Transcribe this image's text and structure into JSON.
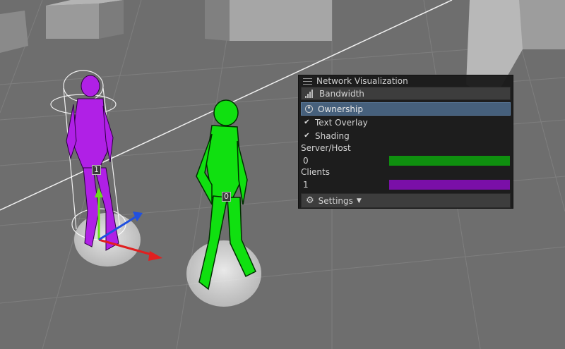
{
  "scene": {
    "labels": [
      {
        "id": "player-1-id-label",
        "text": "1"
      },
      {
        "id": "player-0-id-label",
        "text": "0"
      }
    ],
    "colors": {
      "server_host": "#0f8f0f",
      "client": "#7a0fa8",
      "character_server": "#00d600",
      "character_client": "#b020e6"
    }
  },
  "panel": {
    "title": "Network Visualization",
    "bandwidth_label": "Bandwidth",
    "ownership_label": "Ownership",
    "text_overlay_label": "Text Overlay",
    "shading_label": "Shading",
    "text_overlay_checked": true,
    "shading_checked": true,
    "server_host_label": "Server/Host",
    "server_host_count": "0",
    "clients_label": "Clients",
    "clients_count": "1",
    "settings_label": "Settings",
    "active_mode": "Ownership",
    "check_glyph": "✔",
    "gear_glyph": "⚙",
    "caret_glyph": "▼",
    "icons": [
      "grip-icon",
      "bandwidth-icon",
      "user-circle-icon",
      "gear-icon",
      "caret-down-icon"
    ]
  }
}
